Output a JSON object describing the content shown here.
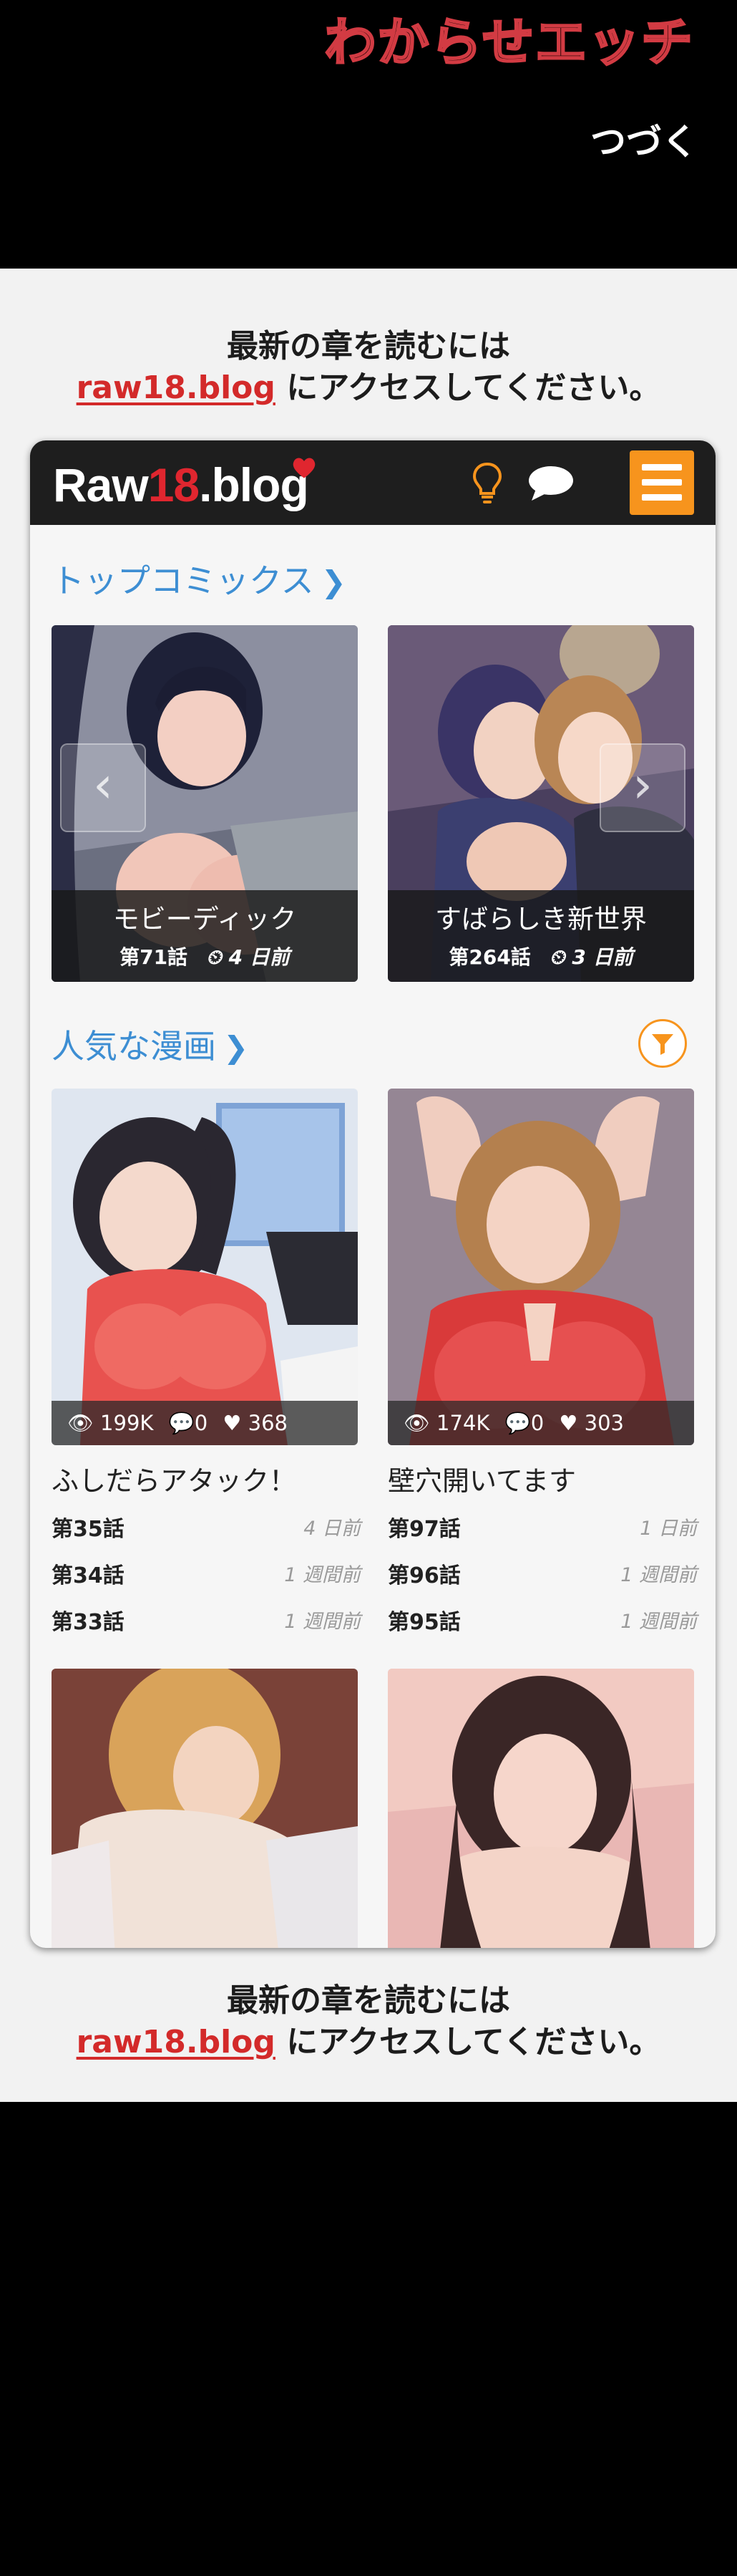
{
  "comic": {
    "title": "わからせエッチ",
    "continued": "つづく"
  },
  "notice": {
    "line1": "最新の章を読むには",
    "link": "raw18.blog",
    "line2_suffix": " にアクセスしてください。"
  },
  "site": {
    "logo_prefix": "Raw",
    "logo_number": "18",
    "logo_suffix": ".blog",
    "icons": [
      "heart-icon",
      "lightbulb-icon",
      "chat-icon",
      "menu-icon",
      "filter-icon"
    ],
    "colors": {
      "accent": "#f7941d",
      "link": "#3d8ed3",
      "brand_red": "#e0262f",
      "header": "#1e1e1e"
    }
  },
  "top_comics": {
    "title": "トップコミックス",
    "items": [
      {
        "title": "モビーディック",
        "chapter": "第71話",
        "time": "4 日前"
      },
      {
        "title": "すばらしき新世界",
        "chapter": "第264話",
        "time": "3 日前"
      }
    ]
  },
  "popular": {
    "title": "人気な漫画",
    "items": [
      {
        "title": "ふしだらアタック！",
        "views": "199K",
        "comments": "0",
        "likes": "368",
        "chapters": [
          {
            "name": "第35話",
            "time": "4 日前"
          },
          {
            "name": "第34話",
            "time": "1 週間前"
          },
          {
            "name": "第33話",
            "time": "1 週間前"
          }
        ]
      },
      {
        "title": "壁穴開いてます",
        "views": "174K",
        "comments": "0",
        "likes": "303",
        "chapters": [
          {
            "name": "第97話",
            "time": "1 日前"
          },
          {
            "name": "第96話",
            "time": "1 週間前"
          },
          {
            "name": "第95話",
            "time": "1 週間前"
          }
        ]
      }
    ]
  }
}
